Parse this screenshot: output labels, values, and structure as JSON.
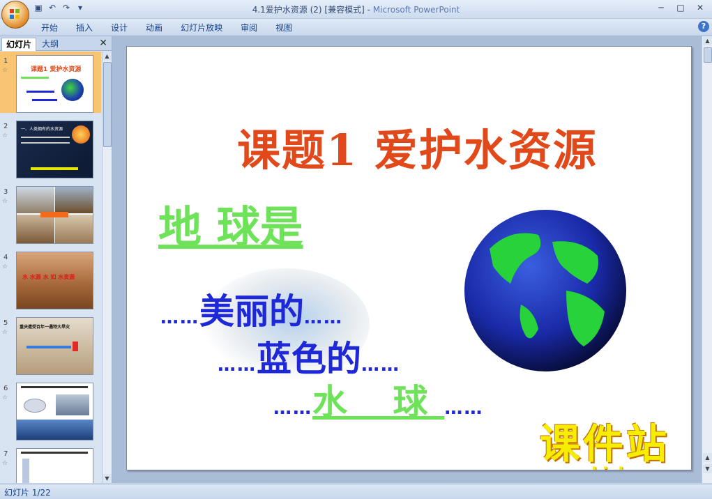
{
  "window": {
    "title": "4.1爱护水资源 (2) [兼容模式] - ",
    "app_name": "Microsoft PowerPoint",
    "minimize": "─",
    "maximize": "□",
    "close": "✕"
  },
  "ribbon": {
    "tabs": [
      "开始",
      "插入",
      "设计",
      "动画",
      "幻灯片放映",
      "审阅",
      "视图"
    ],
    "help": "?"
  },
  "left_pane": {
    "tabs": [
      "幻灯片",
      "大纲"
    ],
    "close": "✕",
    "thumbnails": [
      {
        "number": "1",
        "title": "课题1 爱护水资源"
      },
      {
        "number": "2",
        "title": "一、人类拥有的水资源"
      },
      {
        "number": "3",
        "title": ""
      },
      {
        "number": "4",
        "title": "水 水源 水 如 水资源"
      },
      {
        "number": "5",
        "title": "重庆遭受百年一遇特大旱灾"
      },
      {
        "number": "6",
        "title": ""
      },
      {
        "number": "7",
        "title": ""
      }
    ]
  },
  "slide": {
    "title": "课题1  爱护水资源",
    "earth_is": "地 球是",
    "line1_dots_before": "……",
    "line1_word": "美丽的",
    "line1_dots_after": "……",
    "line2_dots_before": "……",
    "line2_word": "蓝色的",
    "line2_dots_after": "……",
    "line3_dots_before": "……",
    "line3_word": "水  球",
    "line3_dots_after": "……",
    "watermark_cn": "课件站",
    "watermark_url": "www.kjzhan.com"
  },
  "status": {
    "slide_info": "幻灯片 1/22"
  }
}
